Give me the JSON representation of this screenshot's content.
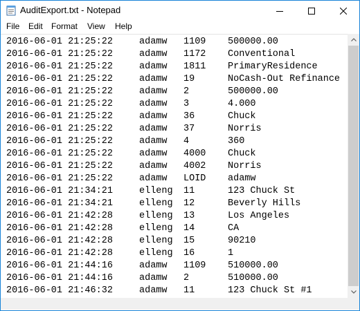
{
  "window": {
    "title": "AuditExport.txt - Notepad"
  },
  "menu": {
    "file": "File",
    "edit": "Edit",
    "format": "Format",
    "view": "View",
    "help": "Help"
  },
  "lines": [
    {
      "timestamp": "2016-06-01 21:25:22",
      "user": "adamw",
      "field": "1109",
      "value": "500000.00"
    },
    {
      "timestamp": "2016-06-01 21:25:22",
      "user": "adamw",
      "field": "1172",
      "value": "Conventional"
    },
    {
      "timestamp": "2016-06-01 21:25:22",
      "user": "adamw",
      "field": "1811",
      "value": "PrimaryResidence"
    },
    {
      "timestamp": "2016-06-01 21:25:22",
      "user": "adamw",
      "field": "19",
      "value": "NoCash-Out Refinance"
    },
    {
      "timestamp": "2016-06-01 21:25:22",
      "user": "adamw",
      "field": "2",
      "value": "500000.00"
    },
    {
      "timestamp": "2016-06-01 21:25:22",
      "user": "adamw",
      "field": "3",
      "value": "4.000"
    },
    {
      "timestamp": "2016-06-01 21:25:22",
      "user": "adamw",
      "field": "36",
      "value": "Chuck"
    },
    {
      "timestamp": "2016-06-01 21:25:22",
      "user": "adamw",
      "field": "37",
      "value": "Norris"
    },
    {
      "timestamp": "2016-06-01 21:25:22",
      "user": "adamw",
      "field": "4",
      "value": "360"
    },
    {
      "timestamp": "2016-06-01 21:25:22",
      "user": "adamw",
      "field": "4000",
      "value": "Chuck"
    },
    {
      "timestamp": "2016-06-01 21:25:22",
      "user": "adamw",
      "field": "4002",
      "value": "Norris"
    },
    {
      "timestamp": "2016-06-01 21:25:22",
      "user": "adamw",
      "field": "LOID",
      "value": "adamw"
    },
    {
      "timestamp": "2016-06-01 21:34:21",
      "user": "elleng",
      "field": "11",
      "value": "123 Chuck St"
    },
    {
      "timestamp": "2016-06-01 21:34:21",
      "user": "elleng",
      "field": "12",
      "value": "Beverly Hills"
    },
    {
      "timestamp": "2016-06-01 21:42:28",
      "user": "elleng",
      "field": "13",
      "value": "Los Angeles"
    },
    {
      "timestamp": "2016-06-01 21:42:28",
      "user": "elleng",
      "field": "14",
      "value": "CA"
    },
    {
      "timestamp": "2016-06-01 21:42:28",
      "user": "elleng",
      "field": "15",
      "value": "90210"
    },
    {
      "timestamp": "2016-06-01 21:42:28",
      "user": "elleng",
      "field": "16",
      "value": "1"
    },
    {
      "timestamp": "2016-06-01 21:44:16",
      "user": "adamw",
      "field": "1109",
      "value": "510000.00"
    },
    {
      "timestamp": "2016-06-01 21:44:16",
      "user": "adamw",
      "field": "2",
      "value": "510000.00"
    },
    {
      "timestamp": "2016-06-01 21:46:32",
      "user": "adamw",
      "field": "11",
      "value": "123 Chuck St #1"
    }
  ],
  "icons": {
    "app": "notepad-icon",
    "minimize": "minimize-icon",
    "maximize": "maximize-icon",
    "close": "close-icon",
    "scroll_up": "scroll-up-arrow-icon",
    "scroll_down": "scroll-down-arrow-icon"
  },
  "colors": {
    "window_border": "#1883d7",
    "scrollbar_track": "#f0f0f0",
    "scrollbar_thumb": "#cdcdcd"
  }
}
